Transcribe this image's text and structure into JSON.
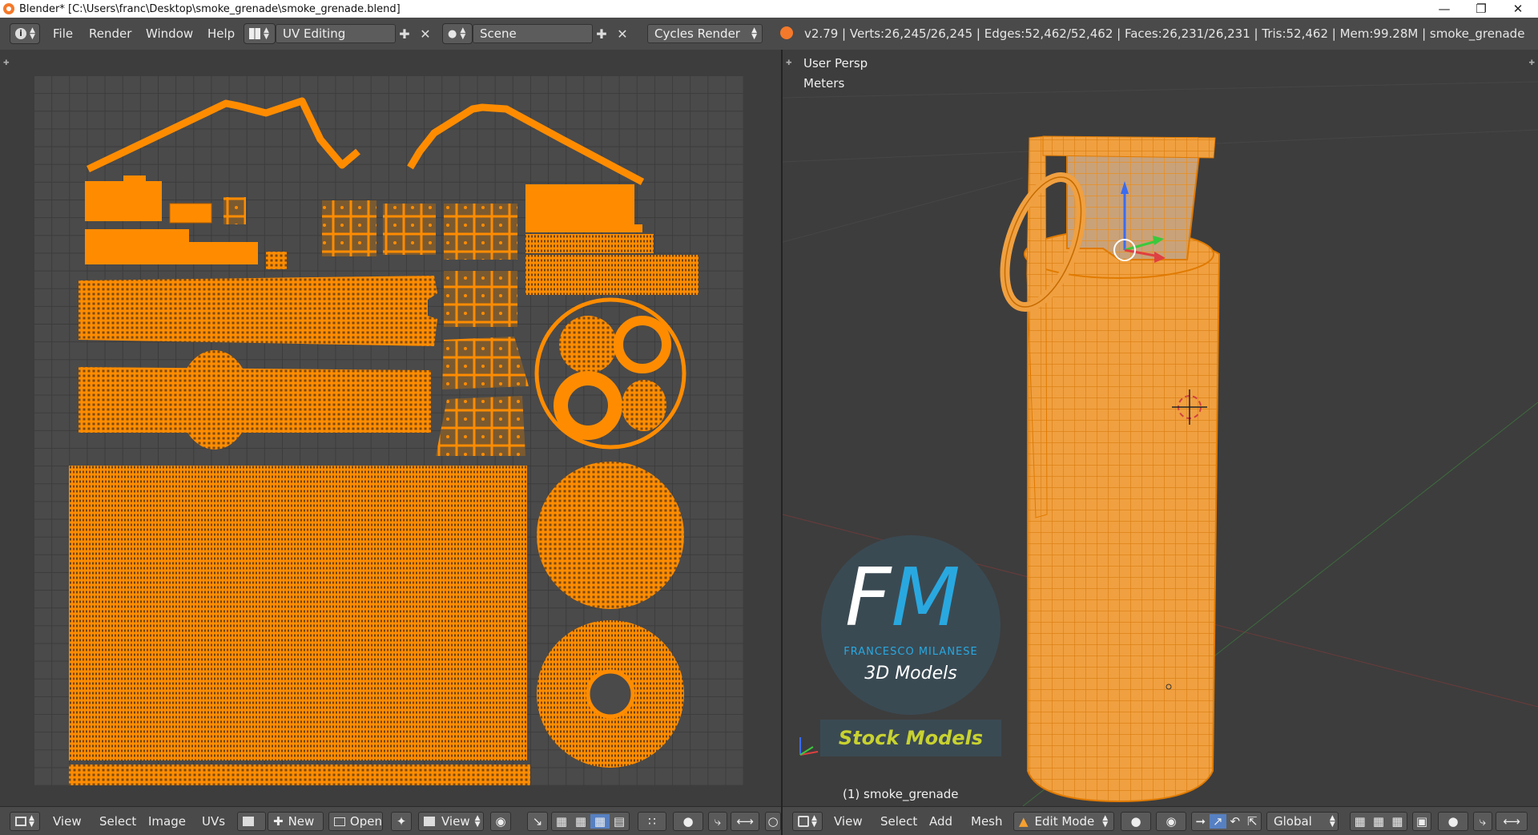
{
  "window": {
    "title": "Blender* [C:\\Users\\franc\\Desktop\\smoke_grenade\\smoke_grenade.blend]",
    "controls": [
      "minimize-icon",
      "restore-icon",
      "close-icon"
    ]
  },
  "info_header": {
    "menus": [
      "File",
      "Render",
      "Window",
      "Help"
    ],
    "screen_layout": "UV Editing",
    "scene": "Scene",
    "render_engine": "Cycles Render",
    "stats": "v2.79 | Verts:26,245/26,245 | Edges:52,462/52,462 | Faces:26,231/26,231 | Tris:52,462 | Mem:99.28M | smoke_grenade"
  },
  "uv_editor": {
    "header_menus": [
      "View",
      "Select",
      "Image",
      "UVs"
    ],
    "new_label": "New",
    "open_label": "Open",
    "view_label": "View",
    "wire_color": "#ff8c00"
  },
  "viewport": {
    "view_name": "User Persp",
    "units": "Meters",
    "object_label": "(1) smoke_grenade",
    "header_menus": [
      "View",
      "Select",
      "Add",
      "Mesh"
    ],
    "mode": "Edit Mode",
    "orientation": "Global",
    "mesh_color": "#f0a040"
  },
  "watermark": {
    "letters": "FM",
    "brand": "FRANCESCO MILANESE",
    "tagline": "3D Models",
    "banner": "Stock Models",
    "accent": "#29a8e0",
    "banner_color": "#c8d230"
  }
}
